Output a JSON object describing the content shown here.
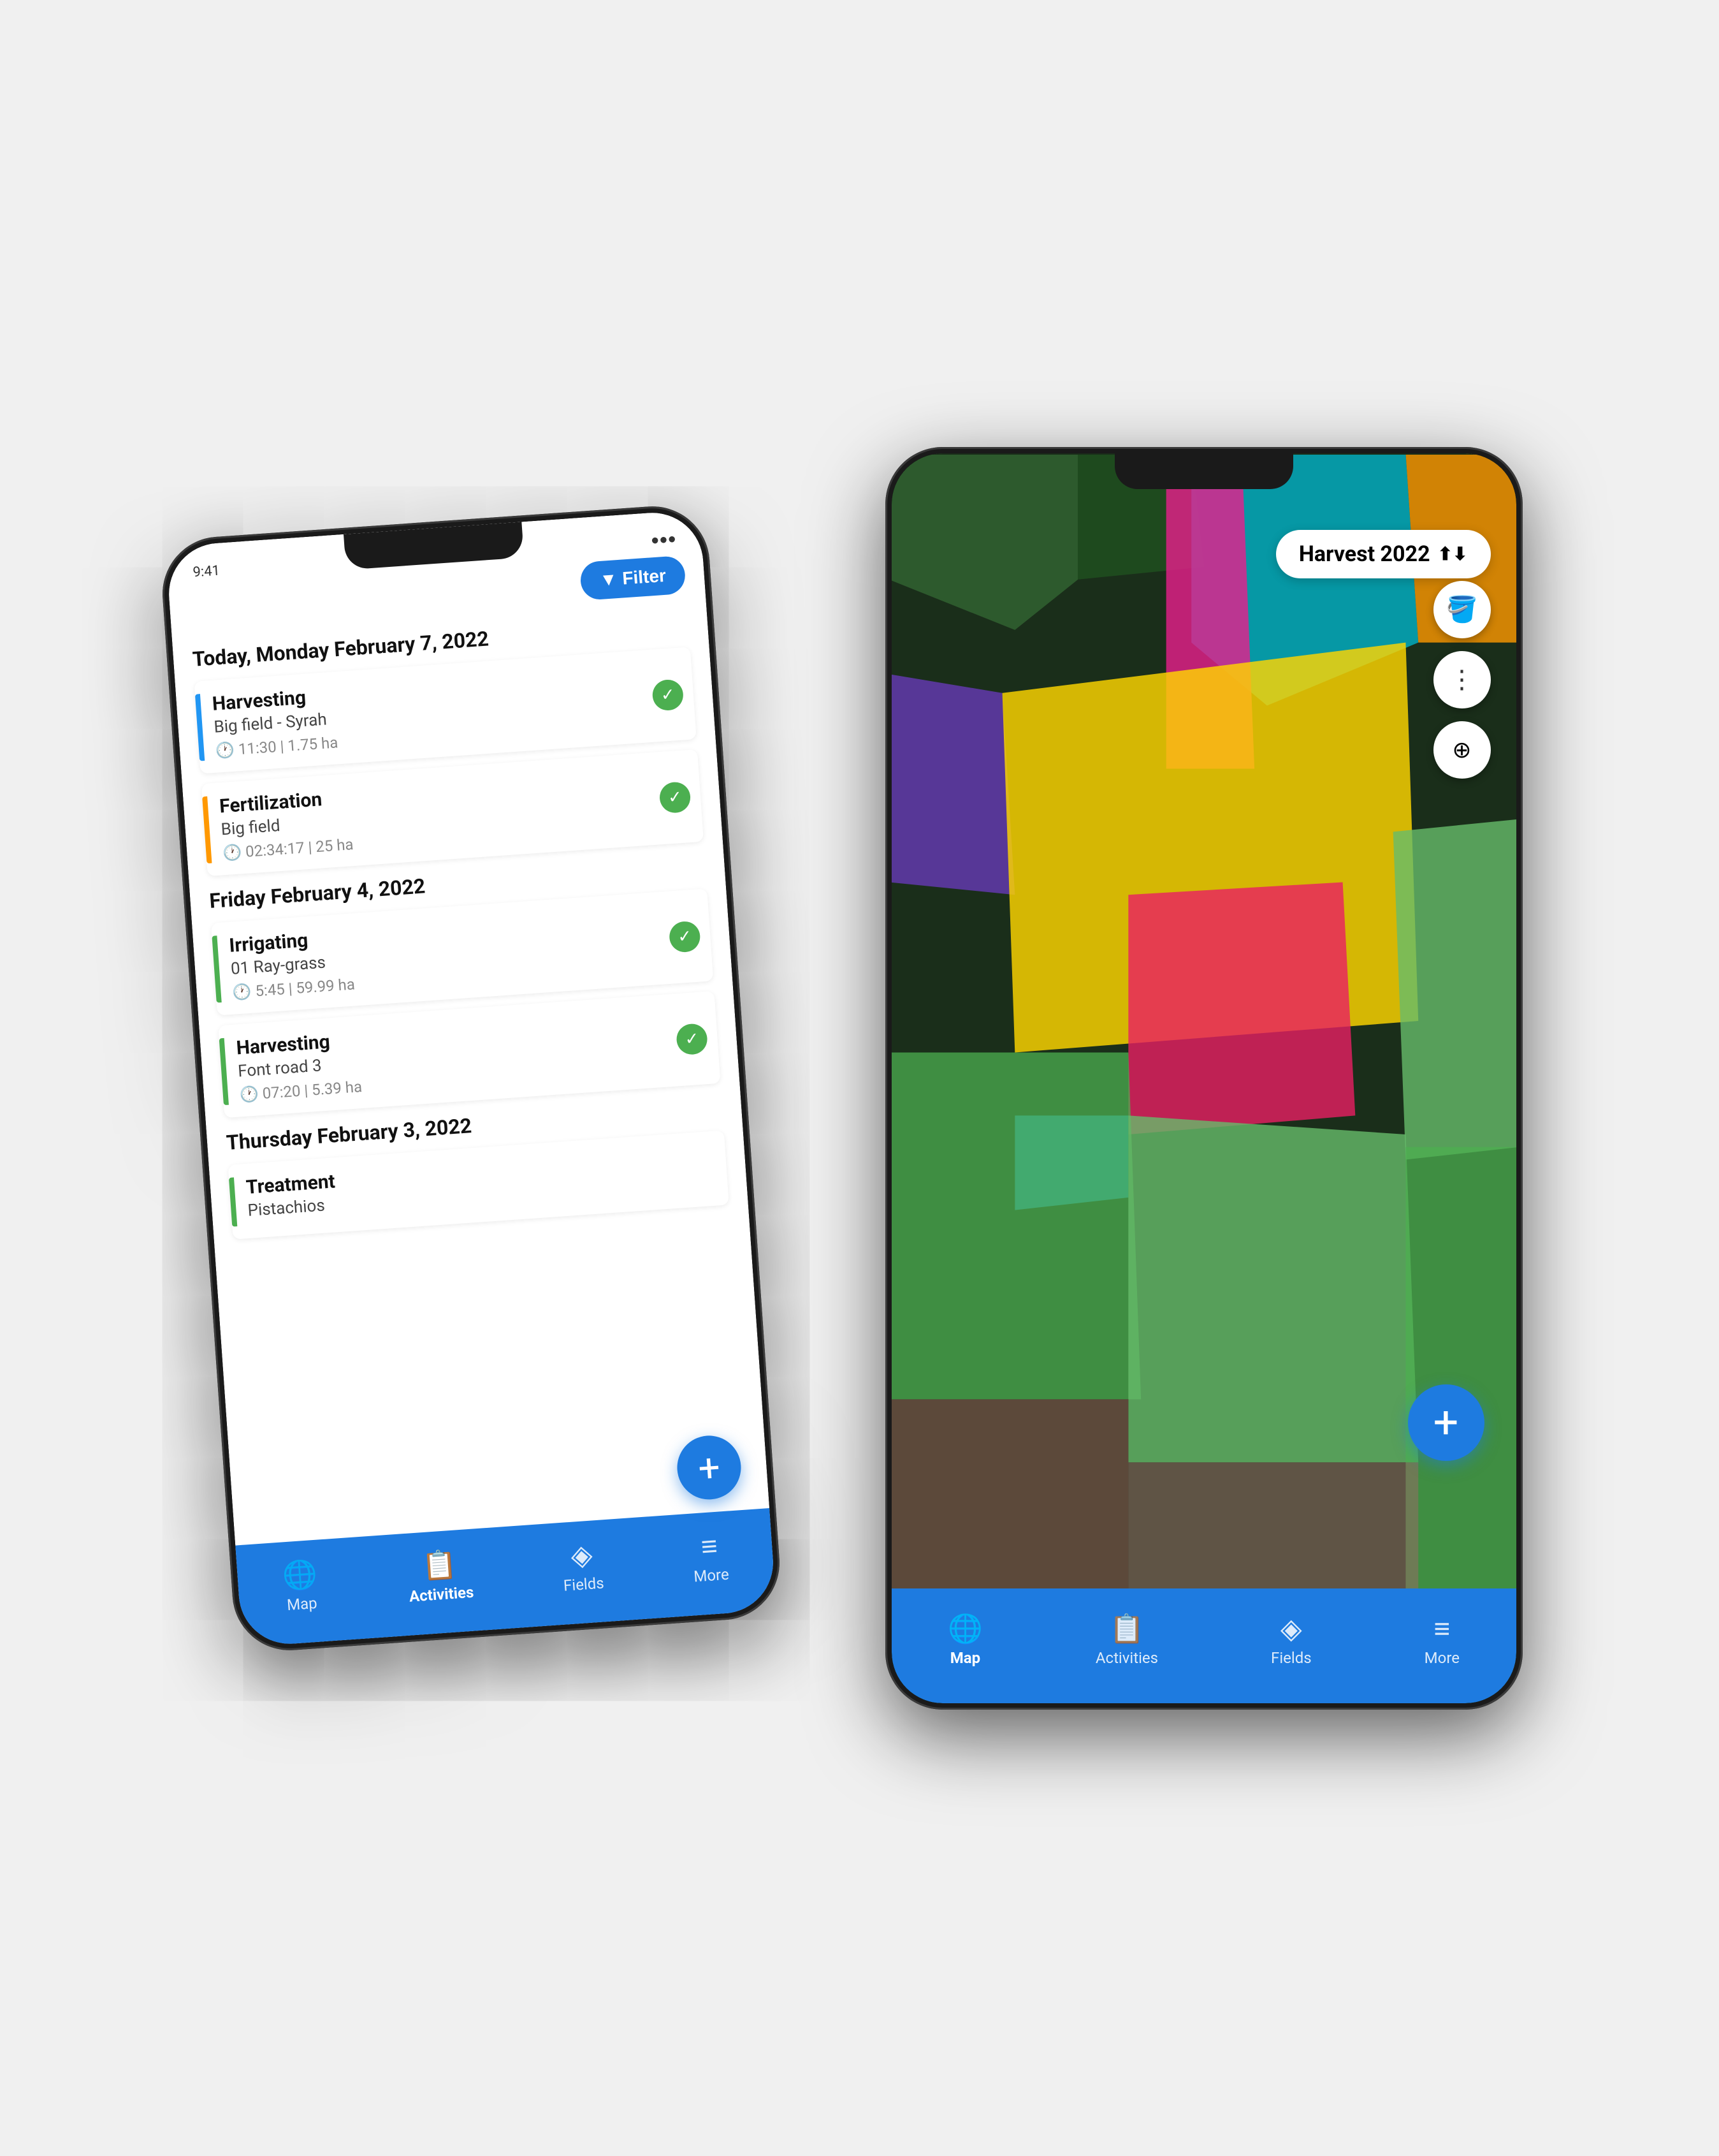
{
  "scene": {
    "bg_color": "#e8e8e8"
  },
  "left_phone": {
    "filter_btn": "Filter",
    "date1": "Today, Monday February 7, 2022",
    "date2": "Friday February 4, 2022",
    "date3": "Thursday February 3, 2022",
    "activities": [
      {
        "type": "Harvesting",
        "subtitle": "Big field - Syrah",
        "time": "11:30 | 1.75 ha",
        "border_color": "blue",
        "checked": true
      },
      {
        "type": "Fertilization",
        "subtitle": "Big field",
        "time": "02:34:17 | 25 ha",
        "border_color": "orange",
        "checked": true
      },
      {
        "type": "Irrigating",
        "subtitle": "01 Ray-grass",
        "time": "5:45 | 59.99 ha",
        "border_color": "green",
        "checked": true
      },
      {
        "type": "Harvesting",
        "subtitle": "Font road 3",
        "time": "07:20 | 5.39 ha",
        "border_color": "green",
        "checked": true
      },
      {
        "type": "Treatment",
        "subtitle": "Pistachios",
        "time": "",
        "border_color": "green",
        "checked": false
      }
    ],
    "nav": [
      {
        "label": "Map",
        "icon": "🌐",
        "active": false
      },
      {
        "label": "Activities",
        "icon": "📋",
        "active": true
      },
      {
        "label": "Fields",
        "icon": "◈",
        "active": false
      },
      {
        "label": "More",
        "icon": "≡",
        "active": false
      }
    ],
    "fab_label": "+"
  },
  "right_phone": {
    "harvest_selector": "Harvest 2022",
    "fab_label": "+",
    "nav": [
      {
        "label": "Map",
        "icon": "🌐",
        "active": true
      },
      {
        "label": "Activities",
        "icon": "📋",
        "active": false
      },
      {
        "label": "Fields",
        "icon": "◈",
        "active": false
      },
      {
        "label": "More",
        "icon": "≡",
        "active": false
      }
    ]
  }
}
